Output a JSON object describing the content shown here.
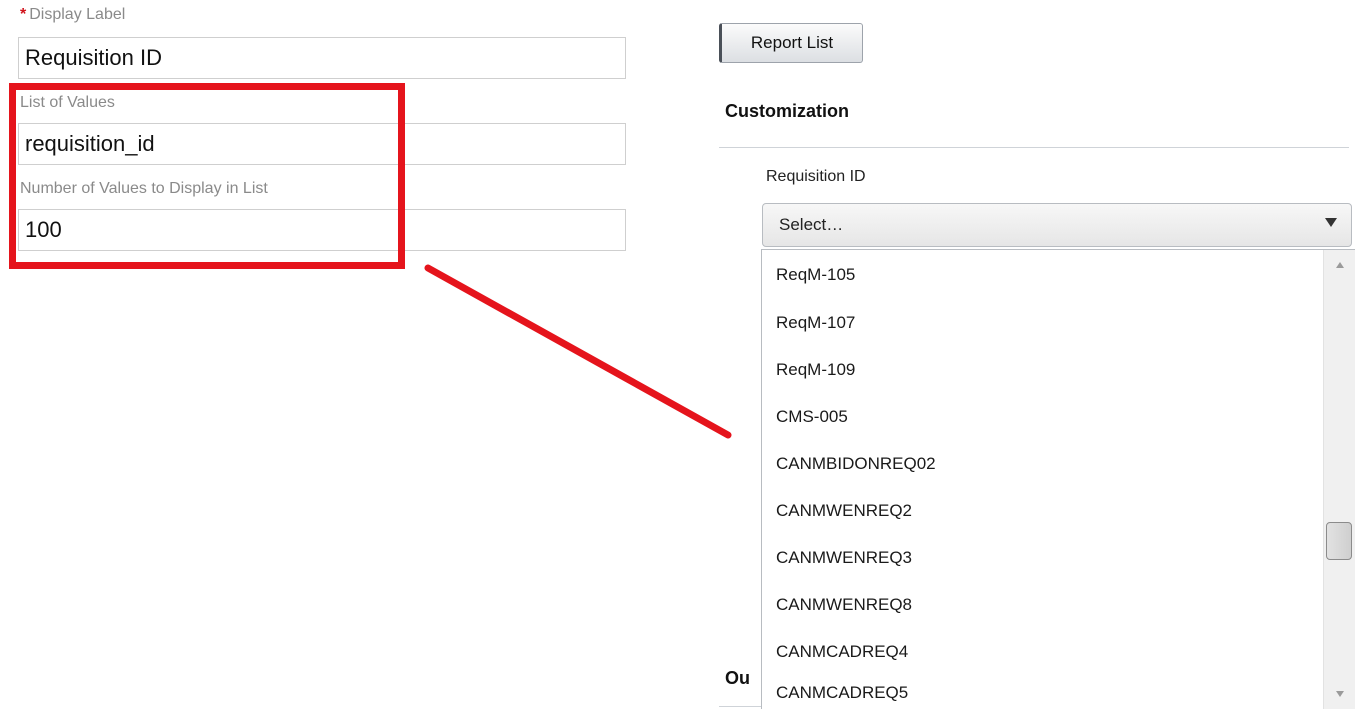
{
  "form": {
    "display_label": {
      "star": "*",
      "label": "Display Label",
      "value": "Requisition ID"
    },
    "list_of_values": {
      "label": "List of Values",
      "value": "requisition_id"
    },
    "num_values": {
      "label": "Number of Values to Display in List",
      "value": "100"
    }
  },
  "annotation": {
    "color": "#e5141c"
  },
  "panel": {
    "report_list_button": "Report List",
    "section_title": "Customization",
    "field_label": "Requisition ID",
    "select_placeholder": "Select…",
    "options": [
      "ReqM-105",
      "ReqM-107",
      "ReqM-109",
      "CMS-005",
      "CANMBIDONREQ02",
      "CANMWENREQ2",
      "CANMWENREQ3",
      "CANMWENREQ8",
      "CANMCADREQ4",
      "CANMCADREQ5"
    ],
    "next_section_partial": "Ou"
  }
}
